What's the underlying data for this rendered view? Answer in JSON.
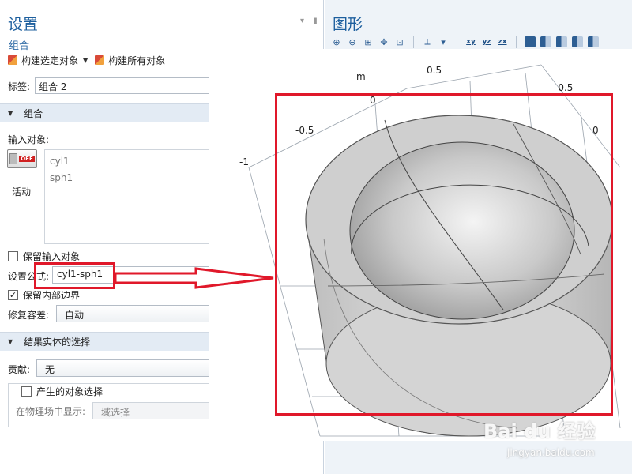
{
  "settings": {
    "title": "设置",
    "subtitle": "组合",
    "build_selected": "构建选定对象",
    "build_all": "构建所有对象",
    "label_caption": "标签:",
    "label_value": "组合 2"
  },
  "section_combine": {
    "header": "组合",
    "input_objects_label": "输入对象:",
    "objects": [
      "cyl1",
      "sph1"
    ],
    "toggle_state": "OFF",
    "toggle_caption": "活动",
    "keep_input_label": "保留输入对象",
    "keep_input_checked": false,
    "formula_label": "设置公式:",
    "formula_value": "cyl1-sph1",
    "keep_interior_label": "保留内部边界",
    "keep_interior_checked": true,
    "repair_label": "修复容差:",
    "repair_value": "自动"
  },
  "section_selection": {
    "header": "结果实体的选择",
    "contribute_label": "贡献:",
    "contribute_value": "无",
    "generate_label": "产生的对象选择",
    "show_in_physics_label": "在物理场中显示:",
    "show_in_physics_value": "域选择"
  },
  "graphics": {
    "title": "图形",
    "axis_labels": {
      "m": "m",
      "a": "0.5",
      "b": "0",
      "c": "-0.5",
      "d": "-0.5",
      "e": "-1",
      "f": "0"
    }
  },
  "watermark": {
    "main": "Bai du 经验",
    "sub": "jingyan.baidu.com"
  },
  "colors": {
    "accent": "#1d5f9e",
    "highlight": "#e0182a"
  }
}
